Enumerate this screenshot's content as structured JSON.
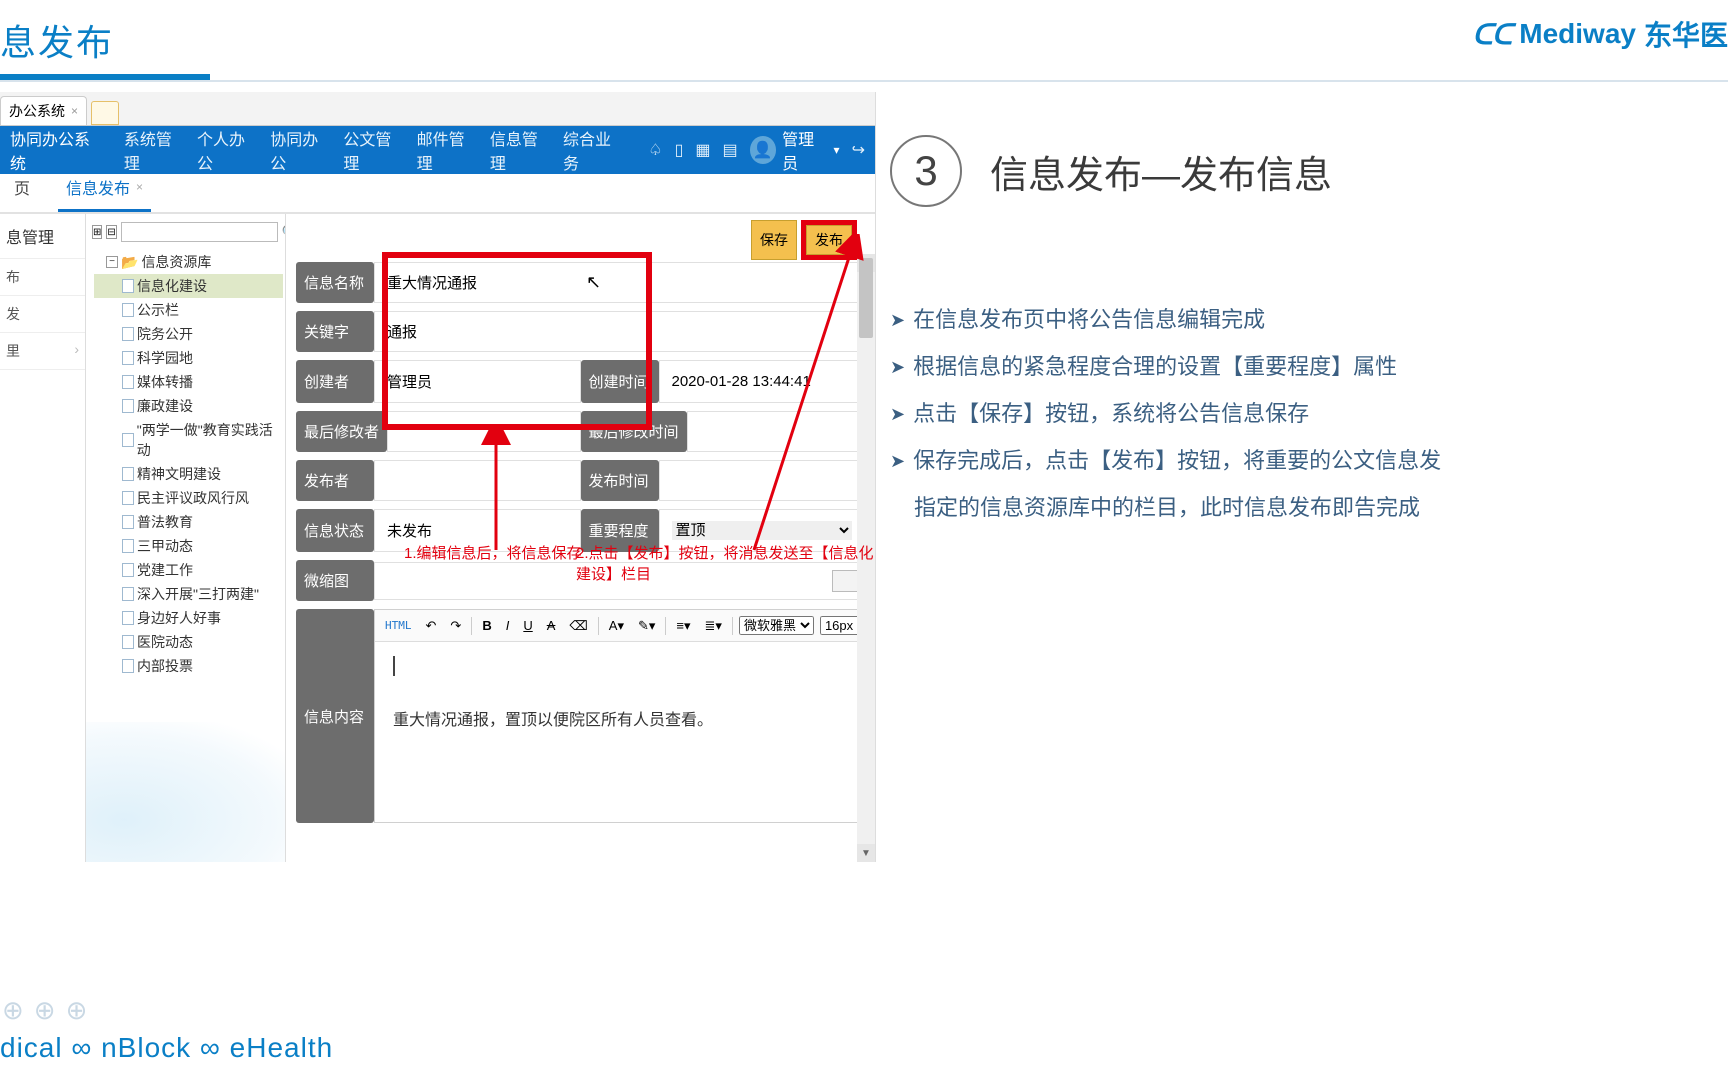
{
  "slide": {
    "title": "息发布",
    "brand_en": "Mediway",
    "brand_cn": "东华医",
    "step_num": "3",
    "step_title": "信息发布—发布信息",
    "bullets": [
      "在信息发布页中将公告信息编辑完成",
      "根据信息的紧急程度合理的设置【重要程度】属性",
      "点击【保存】按钮，系统将公告信息保存",
      "保存完成后，点击【发布】按钮，将重要的公文信息发",
      "指定的信息资源库中的栏目，此时信息发布即告完成"
    ],
    "footer": "dical ∞ nBlock ∞ eHealth"
  },
  "shot": {
    "os_tab": "办公系统",
    "sysname": "协同办公系统",
    "menu": [
      "系统管理",
      "个人办公",
      "协同办公",
      "公文管理",
      "邮件管理",
      "信息管理",
      "综合业务"
    ],
    "user_label": "管理员",
    "tab_home": "页",
    "tab_active": "信息发布",
    "left_panel_header": "息管理",
    "left_items": [
      "布",
      "发",
      "里"
    ],
    "tree_root": "信息资源库",
    "tree_items": [
      "信息化建设",
      "公示栏",
      "院务公开",
      "科学园地",
      "媒体转播",
      "廉政建设",
      "\"两学一做\"教育实践活动",
      "精神文明建设",
      "民主评议政风行风",
      "普法教育",
      "三甲动态",
      "党建工作",
      "深入开展\"三打两建\"",
      "身边好人好事",
      "医院动态",
      "内部投票"
    ],
    "actions": {
      "save": "保存",
      "publish": "发布"
    },
    "form": {
      "name_label": "信息名称",
      "name_value": "重大情况通报",
      "keyword_label": "关键字",
      "keyword_value": "通报",
      "creator_label": "创建者",
      "creator_value": "管理员",
      "create_time_label": "创建时间",
      "create_time_value": "2020-01-28 13:44:41",
      "modifier_label": "最后修改者",
      "modifier_value": "",
      "modify_time_label": "最后修改时间",
      "modify_time_value": "",
      "publisher_label": "发布者",
      "publisher_value": "",
      "publish_time_label": "发布时间",
      "publish_time_value": "",
      "status_label": "信息状态",
      "status_value": "未发布",
      "priority_label": "重要程度",
      "priority_value": "置顶",
      "thumb_label": "微缩图",
      "content_label": "信息内容",
      "content_body": "重大情况通报，置顶以便院区所有人员查看。"
    },
    "editor_font_family": "微软雅黑",
    "editor_font_size": "16px",
    "annot1": "1.编辑信息后，将信息保存",
    "annot2": "2.点击【发布】按钮，将消息发送至【信息化建设】栏目"
  }
}
